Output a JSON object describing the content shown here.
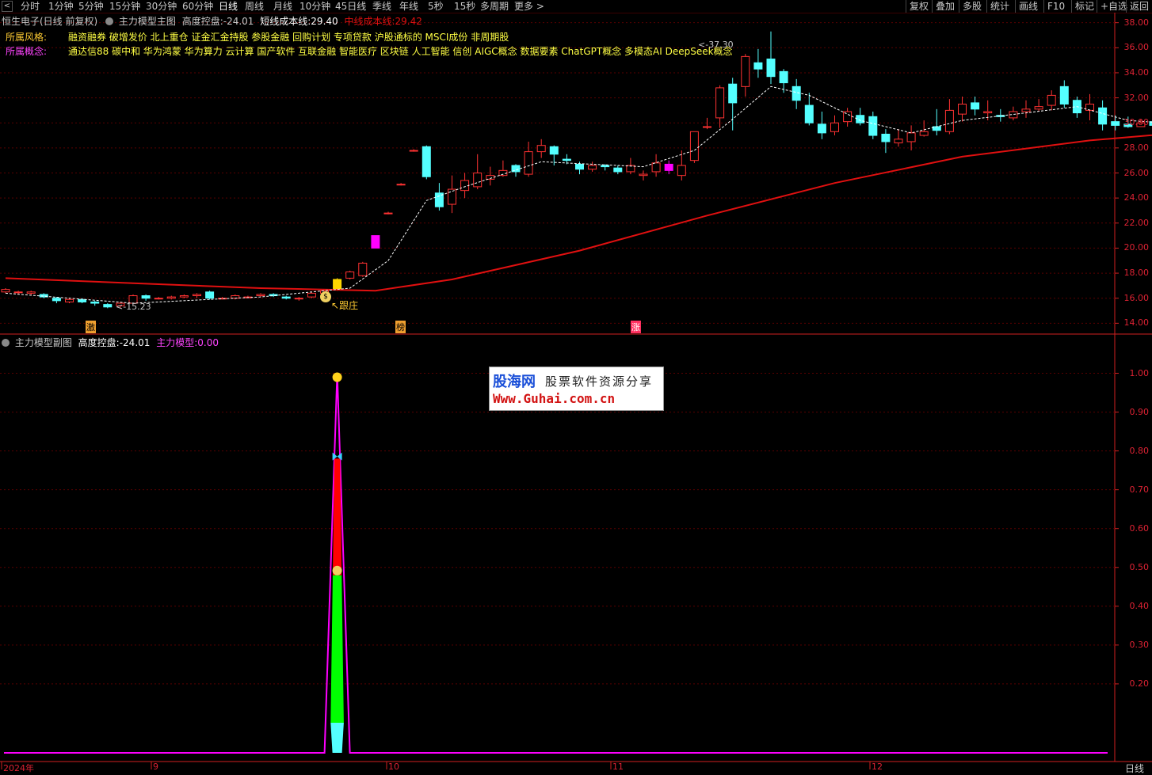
{
  "toolbar": {
    "back_icon": "chevron-left-icon",
    "periods": [
      "分时",
      "1分钟",
      "5分钟",
      "15分钟",
      "30分钟",
      "60分钟",
      "日线",
      "周线",
      "月线",
      "10分钟",
      "45日线",
      "季线",
      "年线",
      "5秒",
      "15秒",
      "多周期",
      "更多 >"
    ],
    "active_period": "日线",
    "right_buttons": [
      "复权",
      "叠加",
      "多股",
      "统计",
      "画线",
      "F10",
      "标记",
      "+自选",
      "返回"
    ]
  },
  "main_header": {
    "stock": "恒生电子(日线 前复权)",
    "indicator": "主力模型主图",
    "k1": "高度控盘:",
    "v1": "-24.01",
    "k2": "短线成本线:",
    "v2": "29.40",
    "k3": "中线成本线:",
    "v3": "29.42"
  },
  "style_line": {
    "label": "所属风格:",
    "text": "融资融券 破增发价 北上重仓 证金汇金持股 参股金融 回购计划 专项贷款 沪股通标的 MSCI成份 非周期股"
  },
  "concept_line": {
    "label": "所属概念:",
    "text": "通达信88 碳中和 华为鸿蒙 华为算力 云计算 国产软件 互联金融 智能医疗 区块链 人工智能 信创 AIGC概念 数据要素 ChatGPT概念 多模态AI DeepSeek概念"
  },
  "main_annotations": {
    "high_label": "37.30",
    "low_label": "15.23",
    "gen_zhuang": "跟庄",
    "markers": [
      "激",
      "榜",
      "涨"
    ]
  },
  "sub_header": {
    "indicator": "主力模型副图",
    "k1": "高度控盘:",
    "v1": "-24.01",
    "k2": "主力模型:",
    "v2": "0.00"
  },
  "main_yaxis": [
    "38.00",
    "36.00",
    "34.00",
    "32.00",
    "30.00",
    "28.00",
    "26.00",
    "24.00",
    "22.00",
    "20.00",
    "18.00",
    "16.00",
    "14.00"
  ],
  "sub_yaxis": [
    "1.00",
    "0.90",
    "0.80",
    "0.70",
    "0.60",
    "0.50",
    "0.40",
    "0.30",
    "0.20"
  ],
  "xaxis": [
    "2024年",
    "9",
    "10",
    "11",
    "12"
  ],
  "period_label": "日线",
  "watermark": {
    "brand": "股海网",
    "slogan": "股票软件资源分享",
    "url": "Www.Guhai.com.cn"
  },
  "colors": {
    "up": "#ff3232",
    "down": "#54ffff",
    "grid": "#5a0000",
    "axis": "#d02020",
    "ma": "#e01010",
    "short_ma": "#ffffff",
    "magenta": "#ff00ff",
    "green": "#00ff00"
  },
  "chart_data": [
    {
      "type": "candlestick",
      "title": "主力模型主图",
      "ylim": [
        13.2,
        38.8
      ],
      "grid": true,
      "candles": [
        [
          16.5,
          16.7,
          16.4,
          16.8
        ],
        [
          16.5,
          16.5,
          16.3,
          16.6
        ],
        [
          16.4,
          16.5,
          16.2,
          16.6
        ],
        [
          16.3,
          16.1,
          16.0,
          16.4
        ],
        [
          16.0,
          15.8,
          15.6,
          16.1
        ],
        [
          15.7,
          15.9,
          15.6,
          16.0
        ],
        [
          15.9,
          15.7,
          15.6,
          16.0
        ],
        [
          15.7,
          15.6,
          15.4,
          15.8
        ],
        [
          15.5,
          15.3,
          15.2,
          15.6
        ],
        [
          15.4,
          15.6,
          15.2,
          15.7
        ],
        [
          15.6,
          16.2,
          15.5,
          16.3
        ],
        [
          16.2,
          16.0,
          15.8,
          16.3
        ],
        [
          16.0,
          16.0,
          15.9,
          16.1
        ],
        [
          16.0,
          16.1,
          15.9,
          16.2
        ],
        [
          16.1,
          16.2,
          16.0,
          16.3
        ],
        [
          16.2,
          16.3,
          16.0,
          16.4
        ],
        [
          16.5,
          16.0,
          15.9,
          16.6
        ],
        [
          16.0,
          16.0,
          15.9,
          16.1
        ],
        [
          16.0,
          16.2,
          15.9,
          16.3
        ],
        [
          16.1,
          16.1,
          16.0,
          16.2
        ],
        [
          16.2,
          16.3,
          16.1,
          16.4
        ],
        [
          16.3,
          16.2,
          16.1,
          16.4
        ],
        [
          16.1,
          16.0,
          15.9,
          16.2
        ],
        [
          16.0,
          16.0,
          15.8,
          16.1
        ],
        [
          16.1,
          16.4,
          16.0,
          16.5
        ],
        [
          16.4,
          16.6,
          16.3,
          16.7
        ],
        [
          16.7,
          17.5,
          16.6,
          17.6
        ],
        [
          17.6,
          18.1,
          17.5,
          18.2
        ],
        [
          17.8,
          18.8,
          17.7,
          18.9
        ],
        [
          20.0,
          21.0,
          20.0,
          21.0
        ],
        [
          22.8,
          22.8,
          22.7,
          22.9
        ],
        [
          25.1,
          25.1,
          25.0,
          25.2
        ],
        [
          27.8,
          27.8,
          27.7,
          27.9
        ],
        [
          28.1,
          25.7,
          25.5,
          28.2
        ],
        [
          24.4,
          23.3,
          23.0,
          25.2
        ],
        [
          23.5,
          24.7,
          22.8,
          25.8
        ],
        [
          24.6,
          25.4,
          24.0,
          26.0
        ],
        [
          24.9,
          26.0,
          24.7,
          27.5
        ],
        [
          25.5,
          25.8,
          25.0,
          26.5
        ],
        [
          25.8,
          26.2,
          25.7,
          27.0
        ],
        [
          26.6,
          26.1,
          25.7,
          26.7
        ],
        [
          25.9,
          27.7,
          25.7,
          28.5
        ],
        [
          27.7,
          28.2,
          27.2,
          28.7
        ],
        [
          28.1,
          27.5,
          26.6,
          28.2
        ],
        [
          27.1,
          27.0,
          26.7,
          27.5
        ],
        [
          26.7,
          26.3,
          25.9,
          26.9
        ],
        [
          26.3,
          26.6,
          26.1,
          26.9
        ],
        [
          26.6,
          26.5,
          26.2,
          26.7
        ],
        [
          26.4,
          26.1,
          25.9,
          26.6
        ],
        [
          26.1,
          26.6,
          25.9,
          27.2
        ],
        [
          25.8,
          25.9,
          25.4,
          26.2
        ],
        [
          26.1,
          26.8,
          25.7,
          27.5
        ],
        [
          26.7,
          26.2,
          25.9,
          27.0
        ],
        [
          25.8,
          26.6,
          25.4,
          27.8
        ],
        [
          27.0,
          29.3,
          26.8,
          29.3
        ],
        [
          29.7,
          29.7,
          29.5,
          30.4
        ],
        [
          30.4,
          32.8,
          29.6,
          33.0
        ],
        [
          33.1,
          31.6,
          29.4,
          33.6
        ],
        [
          32.9,
          35.3,
          32.1,
          35.5
        ],
        [
          34.8,
          34.3,
          33.6,
          35.9
        ],
        [
          35.1,
          33.7,
          33.1,
          37.3
        ],
        [
          34.1,
          33.2,
          32.4,
          34.3
        ],
        [
          32.9,
          31.8,
          31.1,
          33.5
        ],
        [
          31.4,
          30.0,
          29.8,
          32.4
        ],
        [
          29.9,
          29.2,
          28.7,
          30.9
        ],
        [
          29.3,
          30.0,
          29.0,
          30.6
        ],
        [
          30.1,
          30.9,
          29.7,
          31.2
        ],
        [
          30.6,
          30.0,
          29.8,
          31.2
        ],
        [
          30.5,
          29.0,
          28.7,
          30.9
        ],
        [
          29.1,
          28.5,
          27.6,
          29.5
        ],
        [
          28.4,
          28.7,
          28.1,
          29.5
        ],
        [
          28.5,
          29.2,
          27.8,
          29.8
        ],
        [
          29.0,
          29.3,
          28.9,
          30.2
        ],
        [
          29.7,
          29.4,
          29.0,
          31.1
        ],
        [
          29.3,
          31.0,
          29.1,
          31.9
        ],
        [
          30.7,
          31.5,
          30.1,
          32.1
        ],
        [
          31.6,
          31.1,
          30.6,
          32.1
        ],
        [
          30.8,
          30.9,
          30.2,
          31.8
        ],
        [
          30.6,
          30.5,
          30.1,
          31.1
        ],
        [
          30.4,
          30.9,
          30.2,
          31.3
        ],
        [
          30.9,
          31.1,
          30.4,
          31.8
        ],
        [
          31.1,
          31.3,
          30.9,
          31.9
        ],
        [
          31.4,
          32.2,
          31.0,
          32.6
        ],
        [
          32.9,
          31.5,
          31.2,
          33.4
        ],
        [
          31.8,
          30.8,
          30.4,
          32.1
        ],
        [
          31.0,
          31.5,
          30.2,
          32.3
        ],
        [
          31.2,
          29.9,
          29.4,
          31.8
        ],
        [
          30.1,
          29.8,
          29.4,
          30.6
        ],
        [
          29.9,
          29.7,
          29.6,
          30.5
        ],
        [
          29.7,
          30.0,
          29.7,
          30.3
        ],
        [
          30.1,
          29.8,
          29.6,
          30.3
        ],
        [
          29.6,
          29.5,
          29.3,
          30.2
        ],
        [
          29.4,
          29.7,
          29.2,
          29.9
        ],
        [
          29.8,
          29.5,
          29.4,
          30.1
        ],
        [
          29.6,
          29.1,
          28.9,
          30.0
        ],
        [
          29.4,
          29.0,
          29.0,
          29.7
        ],
        [
          29.3,
          29.5,
          29.2,
          29.7
        ],
        [
          29.6,
          29.1,
          28.8,
          30.0
        ],
        [
          29.2,
          29.3,
          29.2,
          30.0
        ]
      ],
      "special_bars": [
        {
          "index": 26,
          "color": "#ffd700"
        },
        {
          "index": 29,
          "color": "#ff00ff"
        },
        {
          "index": 52,
          "color": "#ff00ff"
        }
      ],
      "mid_ma": [
        [
          0,
          17.6
        ],
        [
          10,
          17.2
        ],
        [
          20,
          16.8
        ],
        [
          29,
          16.6
        ],
        [
          35,
          17.5
        ],
        [
          45,
          19.8
        ],
        [
          55,
          22.6
        ],
        [
          65,
          25.2
        ],
        [
          75,
          27.3
        ],
        [
          85,
          28.6
        ],
        [
          92,
          29.2
        ],
        [
          99,
          29.42
        ]
      ],
      "short_ma": [
        [
          0,
          16.4
        ],
        [
          10,
          15.6
        ],
        [
          20,
          16.1
        ],
        [
          27,
          16.8
        ],
        [
          30,
          19.0
        ],
        [
          33,
          23.8
        ],
        [
          36,
          24.9
        ],
        [
          42,
          26.9
        ],
        [
          50,
          26.5
        ],
        [
          54,
          27.8
        ],
        [
          57,
          30.3
        ],
        [
          60,
          32.9
        ],
        [
          63,
          32.2
        ],
        [
          67,
          30.2
        ],
        [
          71,
          29.2
        ],
        [
          75,
          30.2
        ],
        [
          80,
          30.8
        ],
        [
          84,
          31.3
        ],
        [
          88,
          30.2
        ],
        [
          99,
          29.4
        ]
      ]
    },
    {
      "type": "area",
      "title": "主力模型副图",
      "ylim": [
        0,
        1.05
      ],
      "grid": true,
      "spike_index": 26,
      "segments": [
        {
          "color": "#54ffff",
          "from": 0.0,
          "to": 0.1
        },
        {
          "color": "#00ff00",
          "from": 0.1,
          "to": 0.48
        },
        {
          "color": "#ff0000",
          "from": 0.48,
          "to": 0.78
        }
      ],
      "peak": 1.0,
      "icons": {
        "top": "smile-icon",
        "mid": "butterfly-icon",
        "low": "money-bag-icon"
      }
    }
  ]
}
